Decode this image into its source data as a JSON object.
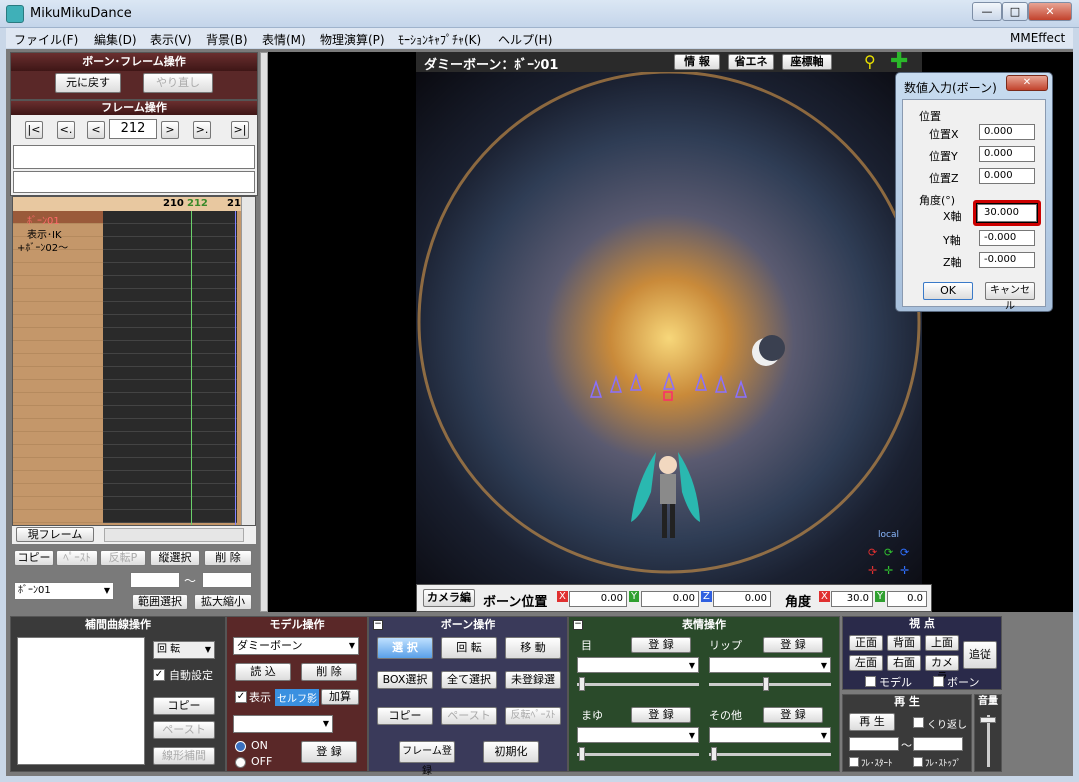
{
  "app": {
    "title": "MikuMikuDance"
  },
  "window_controls": {
    "minimize": "—",
    "maximize": "□",
    "close": "✕"
  },
  "menu": {
    "items": [
      "ファイル(F)",
      "編集(D)",
      "表示(V)",
      "背景(B)",
      "表情(M)",
      "物理演算(P)",
      "ﾓｰｼｮﾝｷｬﾌﾟﾁｬ(K)",
      "ヘルプ(H)"
    ],
    "right": "MMEffect"
  },
  "bone_frame_panel": {
    "title": "ボーン･フレーム操作",
    "undo": "元に戻す",
    "redo": "やり直し"
  },
  "frame_ops": {
    "title": "フレーム操作",
    "first": "|<",
    "prev_key": "<.",
    "prev": "<",
    "frame": "212",
    "next": ">",
    "next_key": ">.",
    "last": ">|"
  },
  "timeline": {
    "ticks": [
      "210",
      "212",
      "21"
    ],
    "rows": [
      "ﾎﾞｰﾝ01",
      "表示･IK",
      "+ﾎﾞｰﾝ02～"
    ],
    "current_frame_button": "現フレーム"
  },
  "timeline_buttons": {
    "copy": "コピー",
    "paste": "ﾍﾟｰｽﾄ",
    "reverse": "反転P",
    "vertical_select": "縦選択",
    "delete": "削 除",
    "bone_select": "ﾎﾞｰﾝ01",
    "tilde": "～",
    "range_select": "範囲選択",
    "scale": "拡大縮小"
  },
  "viewport": {
    "title": "ダミーボーン：ﾎﾞｰﾝ01",
    "info": "情 報",
    "eco": "省エネ",
    "axis": "座標軸",
    "local": "local"
  },
  "dialog": {
    "title": "数値入力(ボーン)",
    "position_label": "位置",
    "px_label": "位置X",
    "py_label": "位置Y",
    "pz_label": "位置Z",
    "px": "0.000",
    "py": "0.000",
    "pz": "0.000",
    "angle_label": "角度(°)",
    "ax_label": "X軸",
    "ay_label": "Y軸",
    "az_label": "Z軸",
    "ax": "30.000",
    "ay": "-0.000",
    "az": "-0.000",
    "ok": "OK",
    "cancel": "キャンセル"
  },
  "status": {
    "camera_edit": "カメラ編",
    "bone_pos": "ボーン位置",
    "x": "X",
    "y": "Y",
    "z": "Z",
    "pos_x": "0.00",
    "pos_y": "0.00",
    "pos_z": "0.00",
    "angle": "角度",
    "ang_x": "30.0",
    "ang_y": "0.0"
  },
  "interp": {
    "title": "補間曲線操作",
    "rotate": "回 転",
    "auto": "自動設定",
    "copy": "コピー",
    "paste": "ペースト",
    "linear": "線形補間"
  },
  "model": {
    "title": "モデル操作",
    "model_select": "ダミーボーン",
    "load": "読 込",
    "delete": "削 除",
    "show": "表示",
    "selfshadow": "セルフ影",
    "add": "加算",
    "on": "ON",
    "off": "OFF",
    "register": "登 録"
  },
  "bone_ops": {
    "title": "ボーン操作",
    "select": "選 択",
    "rotate": "回 転",
    "move": "移 動",
    "box": "BOX選択",
    "select_all": "全て選択",
    "unreg": "未登録選",
    "copy": "コピー",
    "paste": "ペースト",
    "reverse_paste": "反転ﾍﾟｰｽﾄ",
    "frame_reg": "フレーム登録",
    "init": "初期化"
  },
  "face_ops": {
    "title": "表情操作",
    "eye": "目",
    "lip": "リップ",
    "brow": "まゆ",
    "other": "その他",
    "register": "登 録"
  },
  "view": {
    "title": "視 点",
    "front": "正面",
    "back": "背面",
    "top": "上面",
    "left": "左面",
    "right": "右面",
    "camera": "カメラ",
    "follow": "追従",
    "model": "モデル",
    "bone": "ボーン"
  },
  "play": {
    "title": "再 生",
    "play": "再 生",
    "loop": "くり返し",
    "tilde": "～",
    "frame_start": "ﾌﾚ･ｽﾀｰﾄ",
    "frame_stop": "ﾌﾚ･ｽﾄｯﾌﾟ"
  },
  "volume": {
    "title": "音量"
  },
  "colors": {
    "panel_header": "#4a1c1c",
    "face_panel": "#2a4a2a",
    "accent_select": "#5aa0e8",
    "dialog_highlight": "#cc0000"
  }
}
